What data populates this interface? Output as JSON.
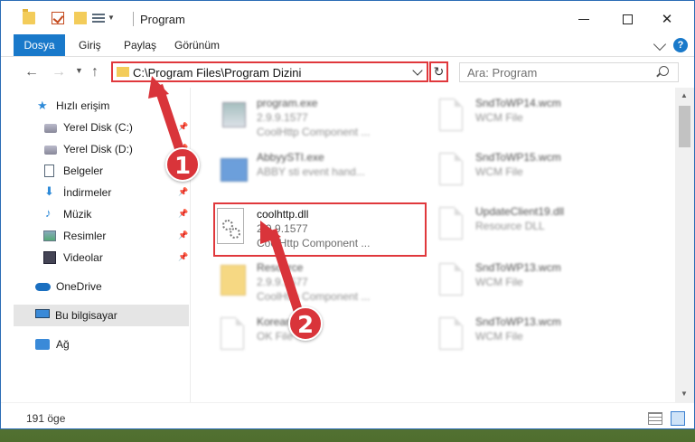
{
  "window": {
    "title": "Program",
    "controls": {
      "minimize": "",
      "maximize": "",
      "close": "✕"
    }
  },
  "ribbon": {
    "tabs": [
      "Dosya",
      "Giriş",
      "Paylaş",
      "Görünüm"
    ],
    "help": "?"
  },
  "address": {
    "path": "C:\\Program Files\\Program Dizini",
    "search_placeholder": "Ara: Program"
  },
  "sidebar": {
    "items": [
      {
        "label": "Hızlı erişim",
        "icon": "star-icon"
      },
      {
        "label": "Yerel Disk (C:)",
        "icon": "disk-icon"
      },
      {
        "label": "Yerel Disk (D:)",
        "icon": "disk-icon"
      },
      {
        "label": "Belgeler",
        "icon": "document-icon"
      },
      {
        "label": "İndirmeler",
        "icon": "download-icon"
      },
      {
        "label": "Müzik",
        "icon": "music-icon"
      },
      {
        "label": "Resimler",
        "icon": "pictures-icon"
      },
      {
        "label": "Videolar",
        "icon": "video-icon"
      },
      {
        "label": "OneDrive",
        "icon": "cloud-icon"
      },
      {
        "label": "Bu bilgisayar",
        "icon": "computer-icon"
      },
      {
        "label": "Ağ",
        "icon": "network-icon"
      }
    ]
  },
  "files": {
    "left": [
      {
        "name": "program.exe",
        "line1": "2.9.9.1577",
        "line2": "CoolHttp Component ..."
      },
      {
        "name": "AbbyySTI.exe",
        "line1": "ABBY sti event hand...",
        "line2": ""
      },
      {
        "name": "coolhttp.dll",
        "line1": "2.9.9.1577",
        "line2": "CoolHttp Component ..."
      },
      {
        "name": "Resource",
        "line1": "2.9.9.1577",
        "line2": "CoolHttp Component ..."
      },
      {
        "name": "Korean",
        "line1": "OK File",
        "line2": ""
      }
    ],
    "right": [
      {
        "name": "SndToWP14.wcm",
        "line1": "WCM File"
      },
      {
        "name": "SndToWP15.wcm",
        "line1": "WCM File"
      },
      {
        "name": "UpdateClient19.dll",
        "line1": "Resource DLL"
      },
      {
        "name": "SndToWP13.wcm",
        "line1": "WCM File"
      },
      {
        "name": "SndToWP13.wcm",
        "line1": "WCM File"
      }
    ]
  },
  "status": {
    "count": "191 öge"
  },
  "annotations": {
    "step1": "1",
    "step2": "2",
    "color": "#d9343a"
  }
}
